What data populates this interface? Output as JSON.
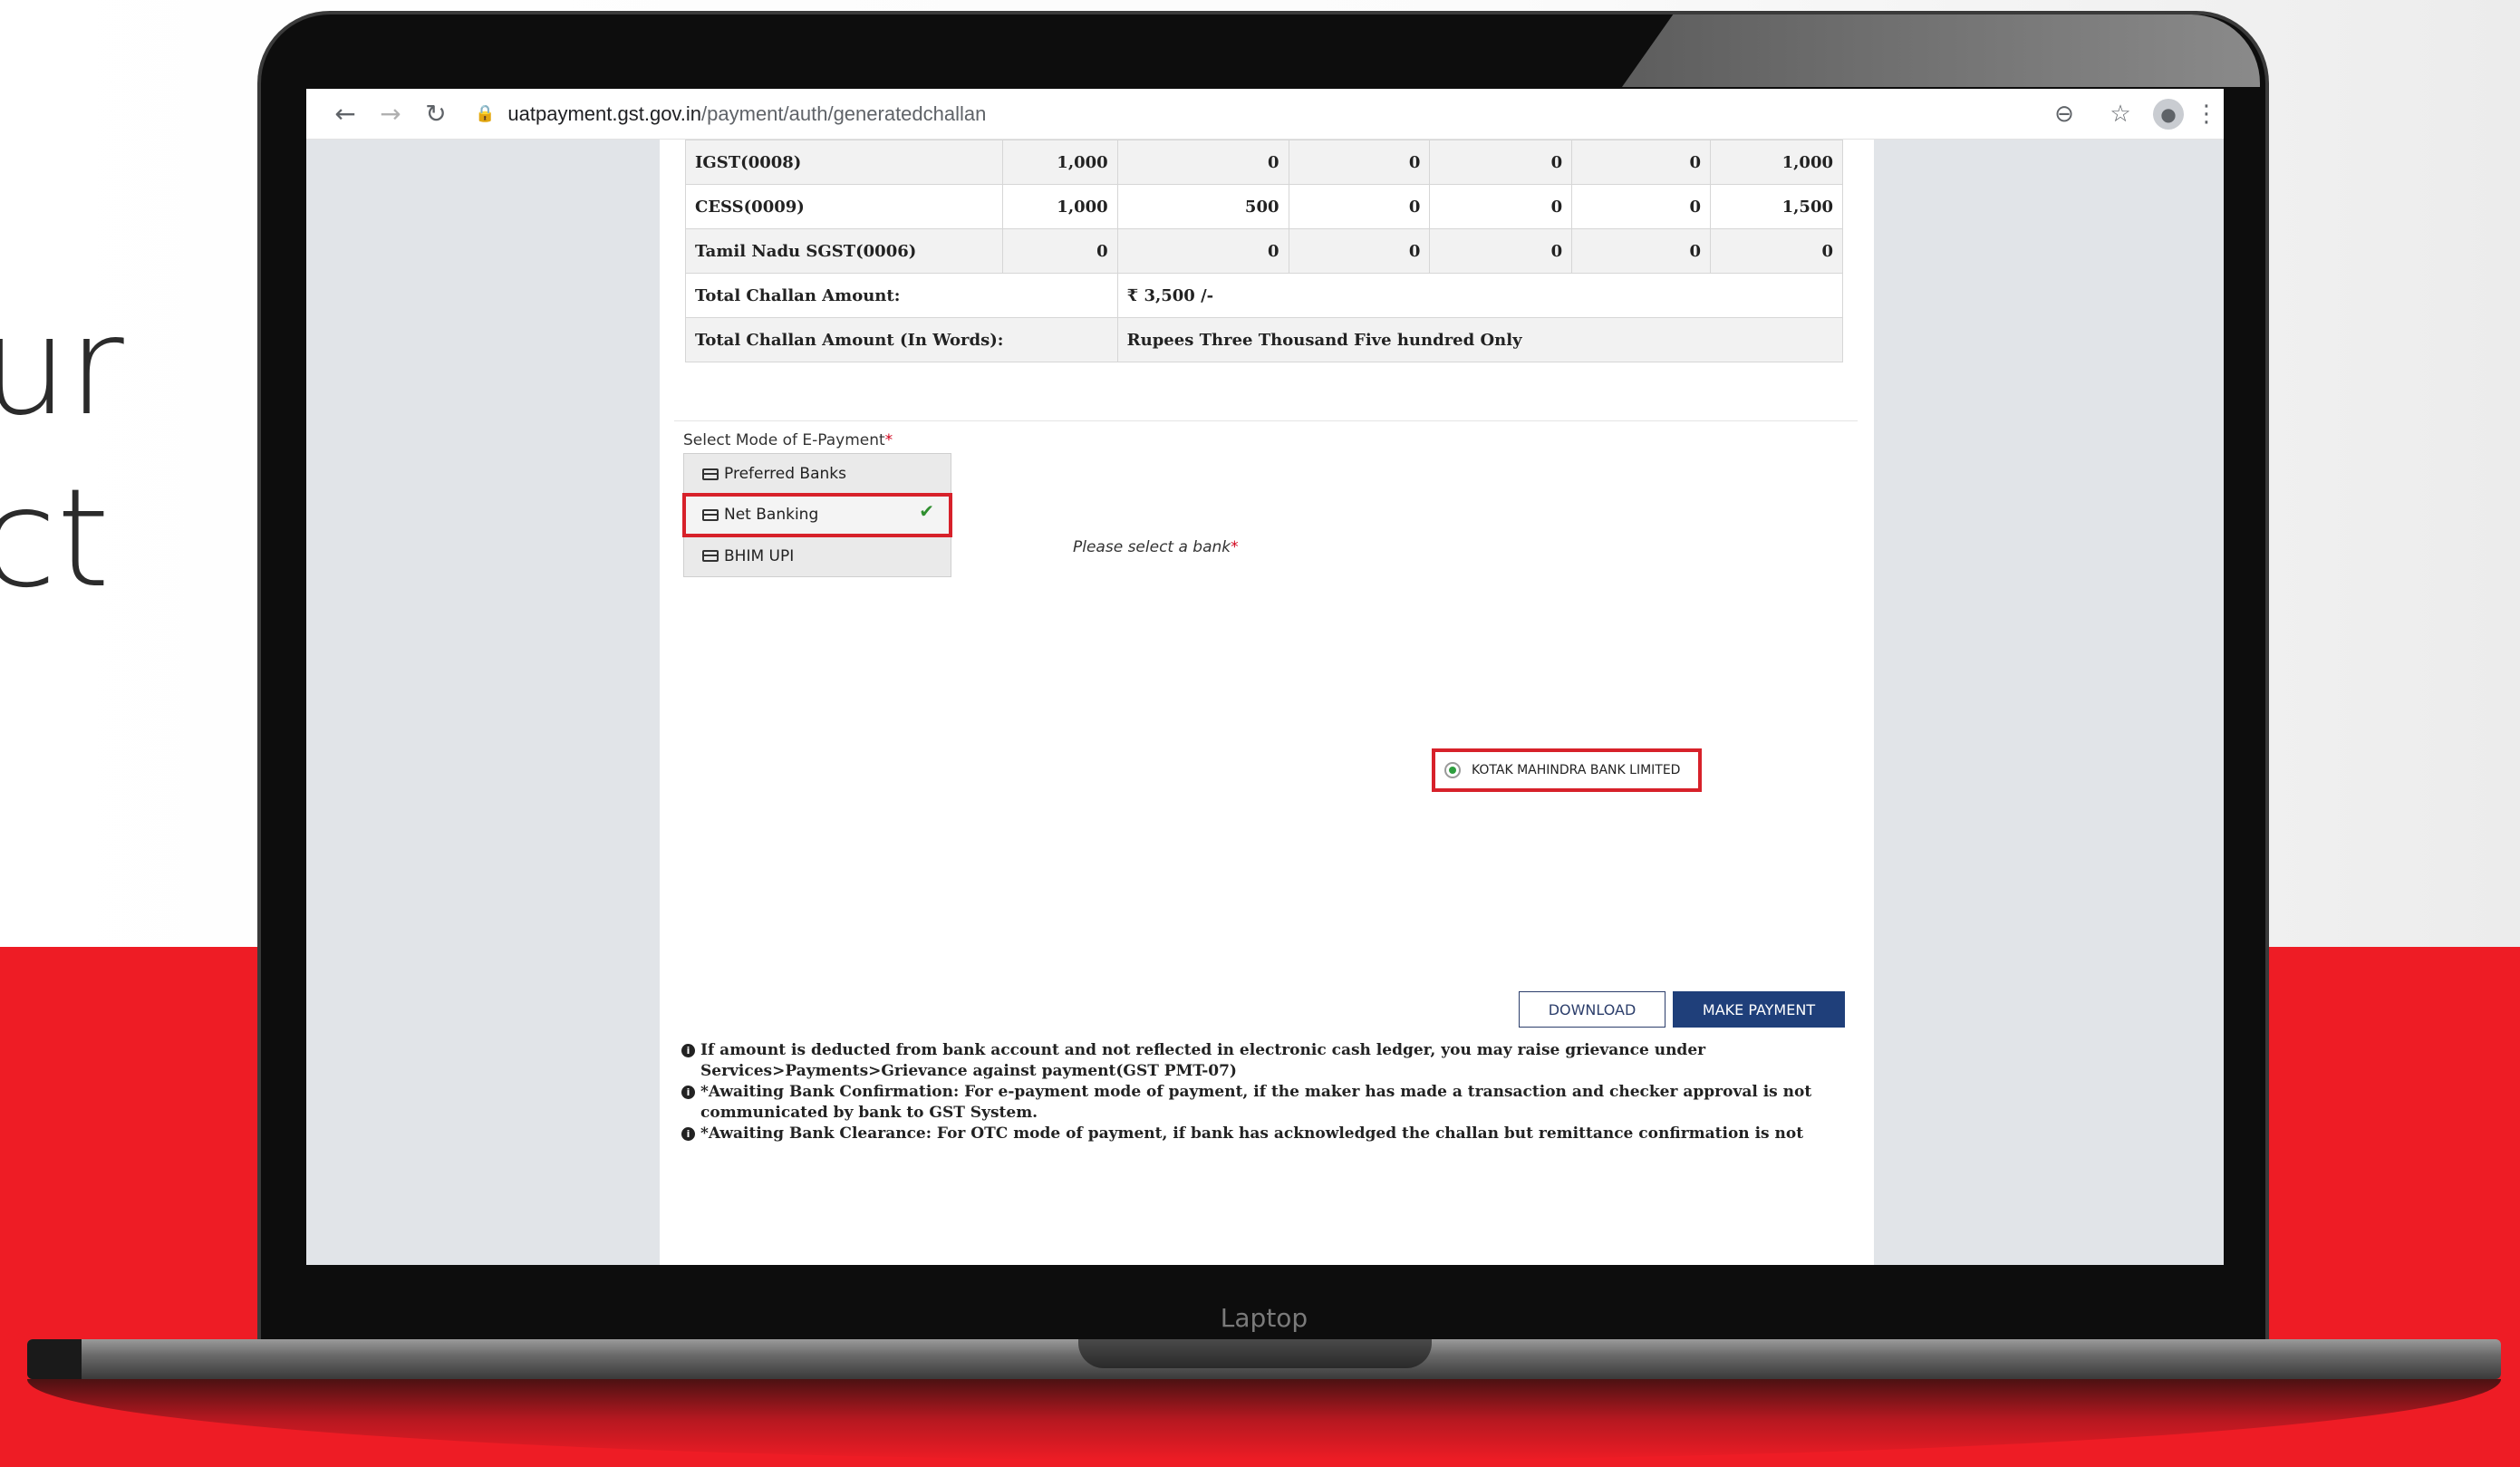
{
  "backdrop": {
    "side_text_line1": "ur",
    "side_text_line2": "ct",
    "laptop_label": "Laptop",
    "accent_color": "#ee1c25"
  },
  "browser": {
    "url_host": "uatpayment.gst.gov.in",
    "url_path": "/payment/auth/generatedchallan",
    "icons": [
      "back-icon",
      "forward-icon",
      "reload-icon",
      "lock-icon",
      "zoom-out-icon",
      "star-icon",
      "profile-icon",
      "menu-icon"
    ]
  },
  "challan_table": {
    "rows": [
      {
        "label": "IGST(0008)",
        "values": [
          "1,000",
          "0",
          "0",
          "0",
          "0",
          "1,000"
        ]
      },
      {
        "label": "CESS(0009)",
        "values": [
          "1,000",
          "500",
          "0",
          "0",
          "0",
          "1,500"
        ]
      },
      {
        "label": "Tamil Nadu SGST(0006)",
        "values": [
          "0",
          "0",
          "0",
          "0",
          "0",
          "0"
        ]
      }
    ],
    "total_label": "Total Challan Amount:",
    "total_value": "₹ 3,500 /-",
    "words_label": "Total Challan Amount (In Words):",
    "words_value": "Rupees Three Thousand Five hundred Only"
  },
  "payment": {
    "mode_label": "Select Mode of E-Payment",
    "required_mark": "*",
    "modes": [
      {
        "label": "Preferred Banks",
        "selected": false
      },
      {
        "label": "Net Banking",
        "selected": true
      },
      {
        "label": "BHIM UPI",
        "selected": false
      }
    ],
    "bank_prompt": "Please select a bank",
    "selected_bank": "KOTAK MAHINDRA BANK LIMITED",
    "download_label": "DOWNLOAD",
    "pay_label": "MAKE PAYMENT"
  },
  "notes": [
    "If amount is deducted from bank account and not reflected in electronic cash ledger, you may raise grievance under Services>Payments>Grievance against payment(GST PMT-07)",
    "*Awaiting Bank Confirmation: For e-payment mode of payment, if the maker has made a transaction and checker approval is not communicated by bank to GST System.",
    "*Awaiting Bank Clearance: For OTC mode of payment, if bank has acknowledged the challan but remittance confirmation is not"
  ]
}
